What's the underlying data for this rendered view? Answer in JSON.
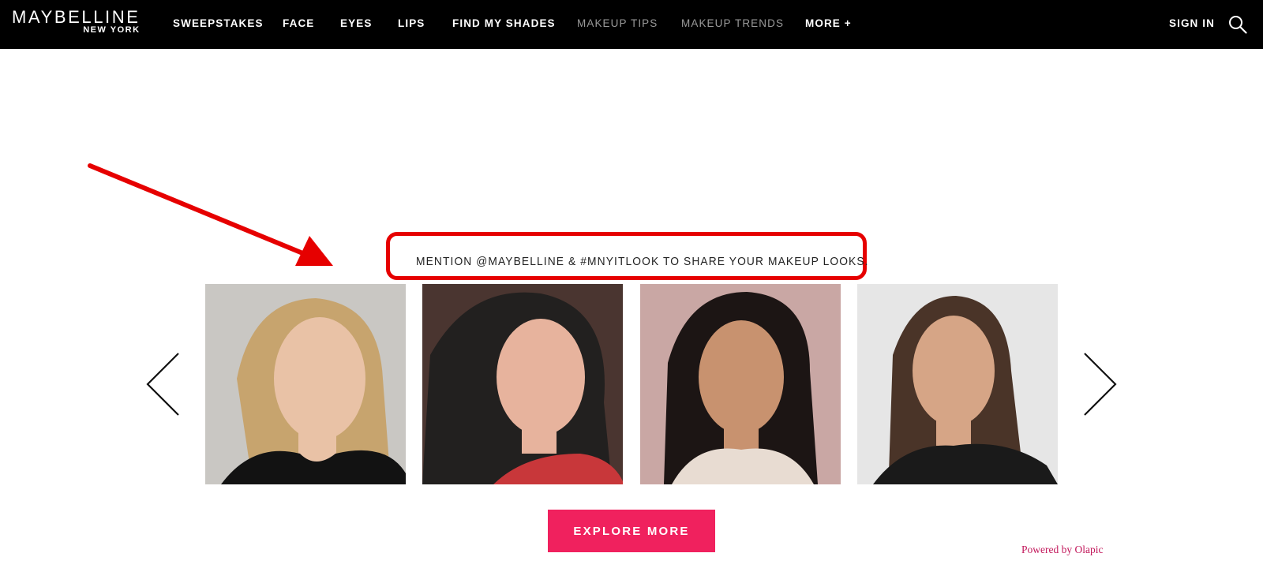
{
  "header": {
    "logo_main": "MAYBELLINE",
    "logo_sub": "NEW YORK",
    "nav": [
      {
        "label": "SWEEPSTAKES"
      },
      {
        "label": "FACE"
      },
      {
        "label": "EYES"
      },
      {
        "label": "LIPS"
      },
      {
        "label": "FIND MY SHADES"
      },
      {
        "label": "MAKEUP TIPS"
      },
      {
        "label": "MAKEUP TRENDS"
      },
      {
        "label": "MORE +"
      }
    ],
    "sign_in": "SIGN IN",
    "search_icon": "search-icon"
  },
  "gallery": {
    "headline": "MENTION @MAYBELLINE & #MNYITLOOK TO SHARE YOUR MAKEUP LOOKS.",
    "prev_icon": "chevron-left-icon",
    "next_icon": "chevron-right-icon",
    "photos": [
      {
        "bg": "#c9c7c3",
        "hair": "#c7a46e",
        "skin": "#e9c2a6",
        "top": "#121212"
      },
      {
        "bg": "#4a3530",
        "hair": "#22201f",
        "skin": "#e7b39d",
        "top": "#c8373a"
      },
      {
        "bg": "#c9a7a4",
        "hair": "#1c1514",
        "skin": "#c8926f",
        "top": "#e8dcd2"
      },
      {
        "bg": "#e6e6e6",
        "hair": "#4a3428",
        "skin": "#d6a586",
        "top": "#1a1a1a"
      }
    ],
    "explore_label": "EXPLORE MORE",
    "powered_by": "Powered by Olapic"
  },
  "colors": {
    "header_bg": "#000000",
    "accent_pink": "#f0215e",
    "annotation_red": "#e60000",
    "powered_link": "#c2185b"
  }
}
